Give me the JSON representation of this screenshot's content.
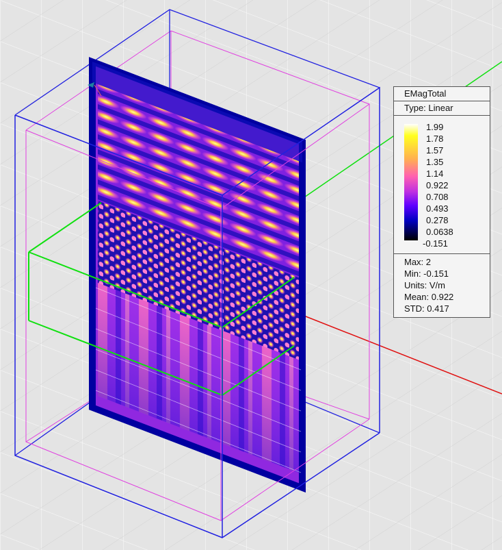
{
  "legend": {
    "title": "EMagTotal",
    "type": "Type: Linear",
    "ticks": [
      "1.99",
      "1.78",
      "1.57",
      "1.35",
      "1.14",
      "0.922",
      "0.708",
      "0.493",
      "0.278",
      "0.0638",
      "-0.151"
    ],
    "stats": [
      "Max: 2",
      "Min: -0.151",
      "Units: V/m",
      "Mean: 0.922",
      "STD: 0.417"
    ]
  },
  "colors": {
    "outer_box": "#2020e0",
    "inner_box": "#e040e0",
    "port_box": "#10e010",
    "axis_x": "#e01010",
    "axis_y": "#10e010"
  }
}
